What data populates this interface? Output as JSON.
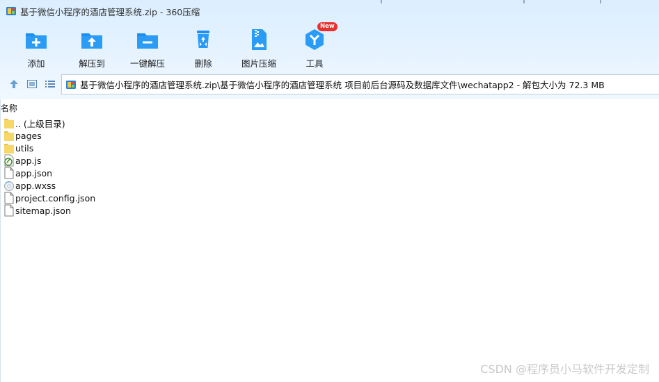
{
  "window": {
    "title": "基于微信小程序的酒店管理系统.zip - 360压缩"
  },
  "toolbar": {
    "items": [
      {
        "label": "添加",
        "icon": "add-folder-icon"
      },
      {
        "label": "解压到",
        "icon": "extract-to-icon"
      },
      {
        "label": "一键解压",
        "icon": "one-click-extract-icon"
      },
      {
        "label": "删除",
        "icon": "recycle-bin-icon"
      },
      {
        "label": "图片压缩",
        "icon": "image-compress-icon"
      },
      {
        "label": "工具",
        "icon": "tools-icon",
        "badge": "New"
      }
    ]
  },
  "navigation": {
    "up_icon": "arrow-up-icon",
    "thumbnail_view_icon": "thumbnail-view-icon",
    "list_view_icon": "list-view-icon",
    "path": "基于微信小程序的酒店管理系统.zip\\基于微信小程序的酒店管理系统 项目前后台源码及数据库文件\\wechatapp2 - 解包大小为 72.3 MB"
  },
  "file_list": {
    "column_name": "名称",
    "items": [
      {
        "name": ".. (上级目录)",
        "type": "folder"
      },
      {
        "name": "pages",
        "type": "folder"
      },
      {
        "name": "utils",
        "type": "folder"
      },
      {
        "name": "app.js",
        "type": "js"
      },
      {
        "name": "app.json",
        "type": "file"
      },
      {
        "name": "app.wxss",
        "type": "wxss"
      },
      {
        "name": "project.config.json",
        "type": "file"
      },
      {
        "name": "sitemap.json",
        "type": "file"
      }
    ]
  },
  "watermark": "CSDN @程序员小马软件开发定制",
  "colors": {
    "accent_blue": "#1e8ff0",
    "folder_yellow": "#f7d768",
    "badge_red": "#e8302f"
  }
}
